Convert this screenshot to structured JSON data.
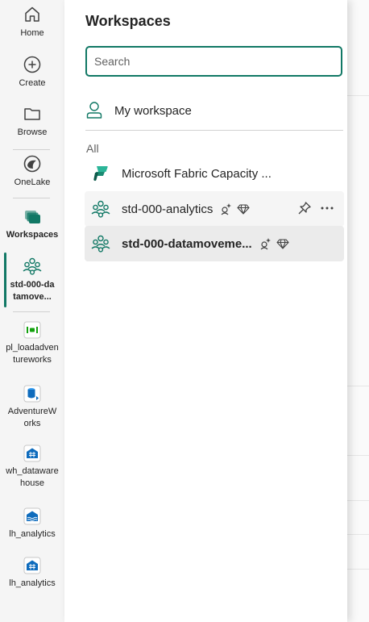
{
  "nav": {
    "home": "Home",
    "create": "Create",
    "browse": "Browse",
    "onelake": "OneLake",
    "workspaces": "Workspaces",
    "current_workspace": "std-000-datamove...",
    "recent": [
      {
        "label": "pl_loadadventureworks",
        "icon": "pipeline-icon"
      },
      {
        "label": "AdventureWorks",
        "icon": "database-icon"
      },
      {
        "label": "wh_datawarehouse",
        "icon": "warehouse-icon"
      },
      {
        "label": "lh_analytics",
        "icon": "lakehouse-icon"
      },
      {
        "label": "lh_analytics",
        "icon": "sql-endpoint-icon"
      }
    ]
  },
  "panel": {
    "title": "Workspaces",
    "search_placeholder": "Search",
    "my_workspace": "My workspace",
    "section_label": "All",
    "workspaces": [
      {
        "name": "Microsoft Fabric Capacity ...",
        "icon": "fabric-logo-icon"
      },
      {
        "name": "std-000-analytics",
        "icon": "workspace-icon"
      },
      {
        "name": "std-000-datamoveme...",
        "icon": "workspace-icon"
      }
    ]
  },
  "colors": {
    "accent": "#117865",
    "fabric_green": "#2bb598"
  }
}
